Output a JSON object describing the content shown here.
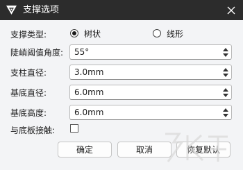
{
  "window": {
    "title": "支撑选项",
    "close_icon": "close-icon",
    "app_icon": "app-logo-icon"
  },
  "support_type": {
    "label": "支撑类型:",
    "options": [
      {
        "label": "树状",
        "selected": true
      },
      {
        "label": "线形",
        "selected": false
      }
    ]
  },
  "fields": [
    {
      "label": "陡峭阈值角度:",
      "value": "55°"
    },
    {
      "label": "支柱直径:",
      "value": "3.0mm"
    },
    {
      "label": "基底直径:",
      "value": "6.0mm"
    },
    {
      "label": "基底高度:",
      "value": "6.0mm"
    }
  ],
  "base_contact": {
    "label": "与底板接触:",
    "checked": false
  },
  "buttons": {
    "ok": "确定",
    "cancel": "取消",
    "reset": "恢复默认"
  },
  "colors": {
    "titlebar": "#2c2c2c",
    "background": "#f3f4f6"
  }
}
